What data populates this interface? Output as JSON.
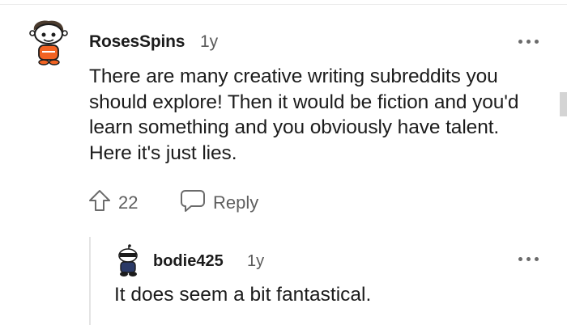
{
  "comment": {
    "username": "RosesSpins",
    "age": "1y",
    "avatar_icon": "snoo-avatar-icon",
    "body": "There are many creative writing subreddits you should explore! Then it would be fiction and you'd learn something and you obviously have talent. Here it's just lies.",
    "upvote_count": "22",
    "reply_label": "Reply",
    "more_icon": "more-options-icon"
  },
  "reply": {
    "username": "bodie425",
    "age": "1y",
    "avatar_icon": "snoo-avatar-icon",
    "body": "It does seem a bit fantastical.",
    "more_icon": "more-options-icon"
  },
  "colors": {
    "text": "#1c1c1c",
    "meta": "#5f5f5f",
    "avatar_orange": "#f26322"
  }
}
